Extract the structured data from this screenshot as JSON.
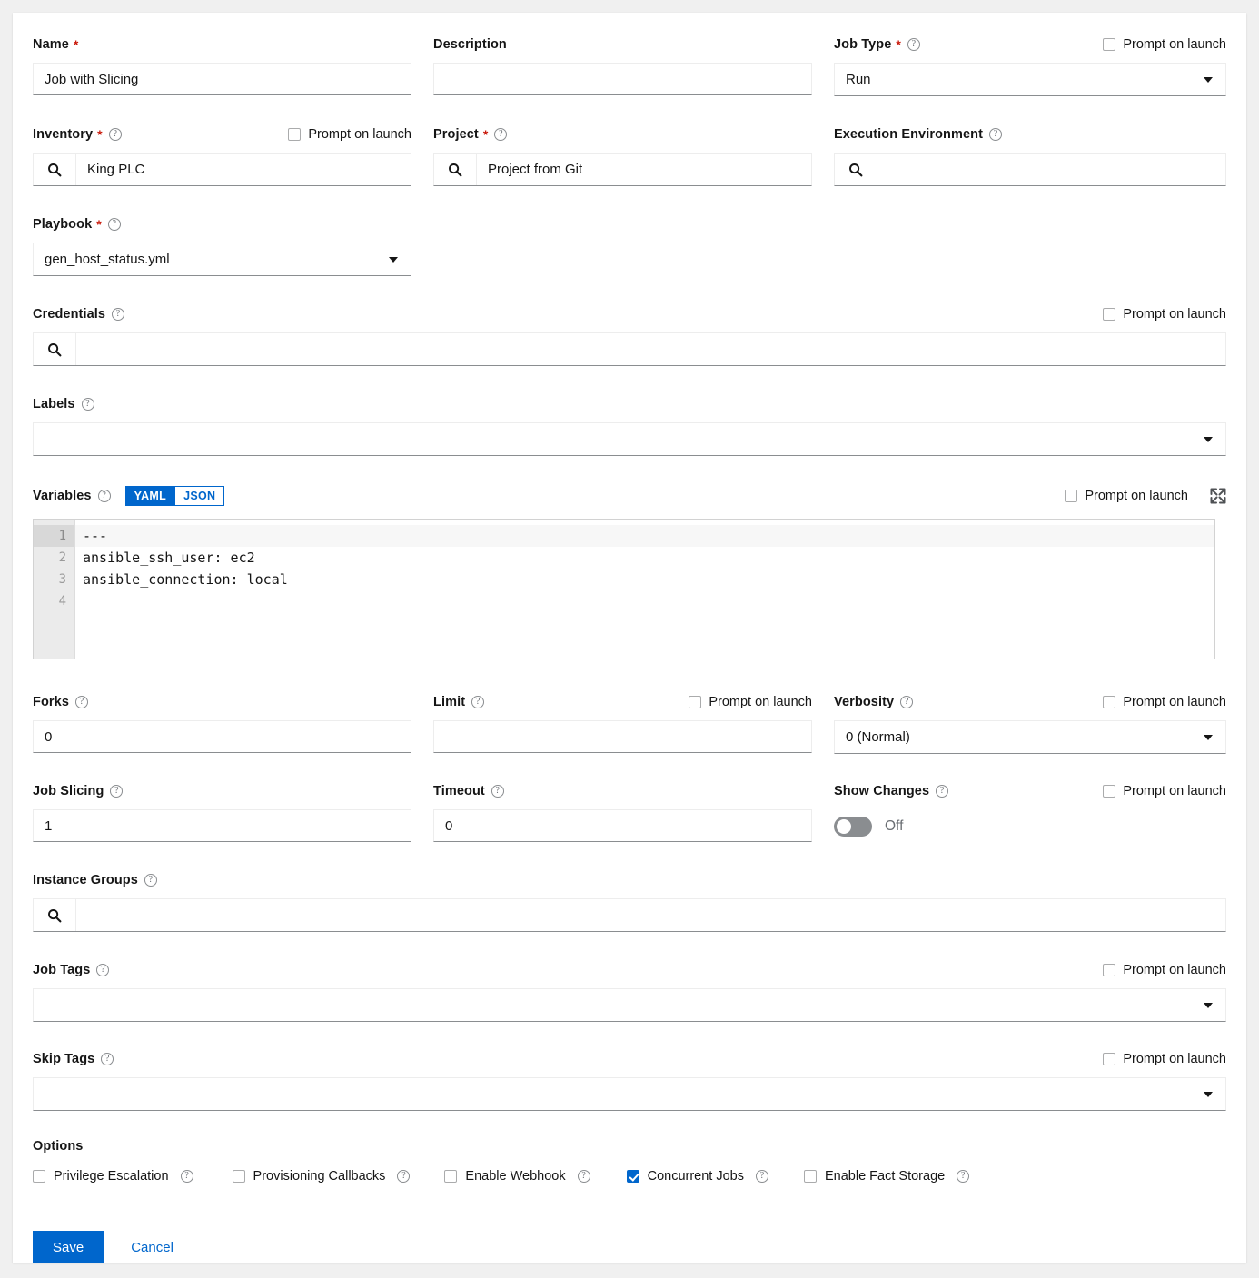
{
  "common": {
    "prompt_on_launch": "Prompt on launch",
    "help_icon": "question-circle-icon",
    "search_icon": "search-icon",
    "expand_icon": "expand-arrows-icon",
    "accent_color": "#0066cc",
    "required_color": "#c9190b"
  },
  "fields": {
    "name": {
      "label": "Name",
      "required": "*",
      "value": "Job with Slicing"
    },
    "description": {
      "label": "Description",
      "value": ""
    },
    "job_type": {
      "label": "Job Type",
      "required": "*",
      "value": "Run",
      "prompt": "Prompt on launch",
      "prompt_checked": false
    },
    "inventory": {
      "label": "Inventory",
      "required": "*",
      "value": "King PLC",
      "prompt": "Prompt on launch",
      "prompt_checked": false
    },
    "project": {
      "label": "Project",
      "required": "*",
      "value": "Project from Git"
    },
    "execution_environment": {
      "label": "Execution Environment",
      "value": ""
    },
    "playbook": {
      "label": "Playbook",
      "required": "*",
      "value": "gen_host_status.yml"
    },
    "credentials": {
      "label": "Credentials",
      "value": "",
      "prompt": "Prompt on launch",
      "prompt_checked": false
    },
    "labels": {
      "label": "Labels",
      "value": ""
    },
    "variables": {
      "label": "Variables",
      "modes": [
        "YAML",
        "JSON"
      ],
      "active_mode": "YAML",
      "prompt": "Prompt on launch",
      "prompt_checked": false,
      "lines": [
        "---",
        "ansible_ssh_user: ec2",
        "ansible_connection: local",
        ""
      ],
      "line_numbers": [
        "1",
        "2",
        "3",
        "4"
      ]
    },
    "forks": {
      "label": "Forks",
      "value": "0"
    },
    "limit": {
      "label": "Limit",
      "value": "",
      "prompt": "Prompt on launch",
      "prompt_checked": false
    },
    "verbosity": {
      "label": "Verbosity",
      "value": "0 (Normal)",
      "prompt": "Prompt on launch",
      "prompt_checked": false
    },
    "job_slicing": {
      "label": "Job Slicing",
      "value": "1"
    },
    "timeout": {
      "label": "Timeout",
      "value": "0"
    },
    "show_changes": {
      "label": "Show Changes",
      "state": "Off",
      "on": false,
      "prompt": "Prompt on launch",
      "prompt_checked": false
    },
    "instance_groups": {
      "label": "Instance Groups",
      "value": ""
    },
    "job_tags": {
      "label": "Job Tags",
      "value": "",
      "prompt": "Prompt on launch",
      "prompt_checked": false
    },
    "skip_tags": {
      "label": "Skip Tags",
      "value": "",
      "prompt": "Prompt on launch",
      "prompt_checked": false
    }
  },
  "options": {
    "title": "Options",
    "items": [
      {
        "label": "Privilege Escalation",
        "checked": false
      },
      {
        "label": "Provisioning Callbacks",
        "checked": false
      },
      {
        "label": "Enable Webhook",
        "checked": false
      },
      {
        "label": "Concurrent Jobs",
        "checked": true
      },
      {
        "label": "Enable Fact Storage",
        "checked": false
      }
    ]
  },
  "actions": {
    "save": "Save",
    "cancel": "Cancel"
  }
}
